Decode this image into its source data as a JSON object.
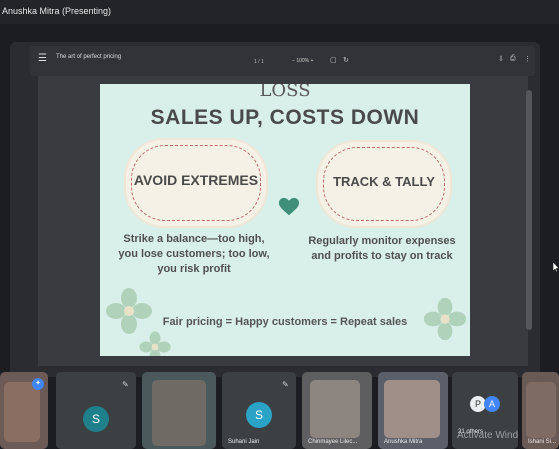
{
  "presenter": {
    "label": "Anushka Mitra (Presenting)"
  },
  "toolbar": {
    "menu_icon": "hamburger-icon",
    "doc_title": "The art of perfect pricing",
    "page": "1 / 1",
    "zoom_minus": "−",
    "zoom": "100%",
    "zoom_plus": "+",
    "fit_icon": "fit-page-icon",
    "rotate_icon": "rotate-icon",
    "download_icon": "download-icon",
    "print_icon": "print-icon",
    "more_icon": "more-vertical-icon"
  },
  "slide": {
    "top_partial": "LOSS",
    "title": "SALES UP, COSTS DOWN",
    "left_heading": "AVOID EXTREMES",
    "left_desc_1": "Strike a balance—too high,",
    "left_desc_2": "you lose customers; too low,",
    "left_desc_3": "you risk profit",
    "right_heading": "TRACK & TALLY",
    "right_desc_1": "Regularly monitor expenses",
    "right_desc_2": "and profits to stay on track",
    "footer": "Fair pricing = Happy customers = Repeat sales",
    "colors": {
      "background": "#d9efe9",
      "heart": "#3f8f7a",
      "dash": "#b86b6b"
    }
  },
  "participants": [
    {
      "name": "",
      "initial": ""
    },
    {
      "name": "",
      "initial": "S"
    },
    {
      "name": "",
      "initial": ""
    },
    {
      "name": "Suhani Jain",
      "initial": "S"
    },
    {
      "name": "Chinmayee Lilec...",
      "initial": ""
    },
    {
      "name": "Anushka Mitra",
      "initial": ""
    },
    {
      "name": "21 others",
      "initial": "P"
    },
    {
      "name": "Ishani Si...",
      "initial": ""
    }
  ],
  "watermark": {
    "text": "Activate Wind"
  }
}
